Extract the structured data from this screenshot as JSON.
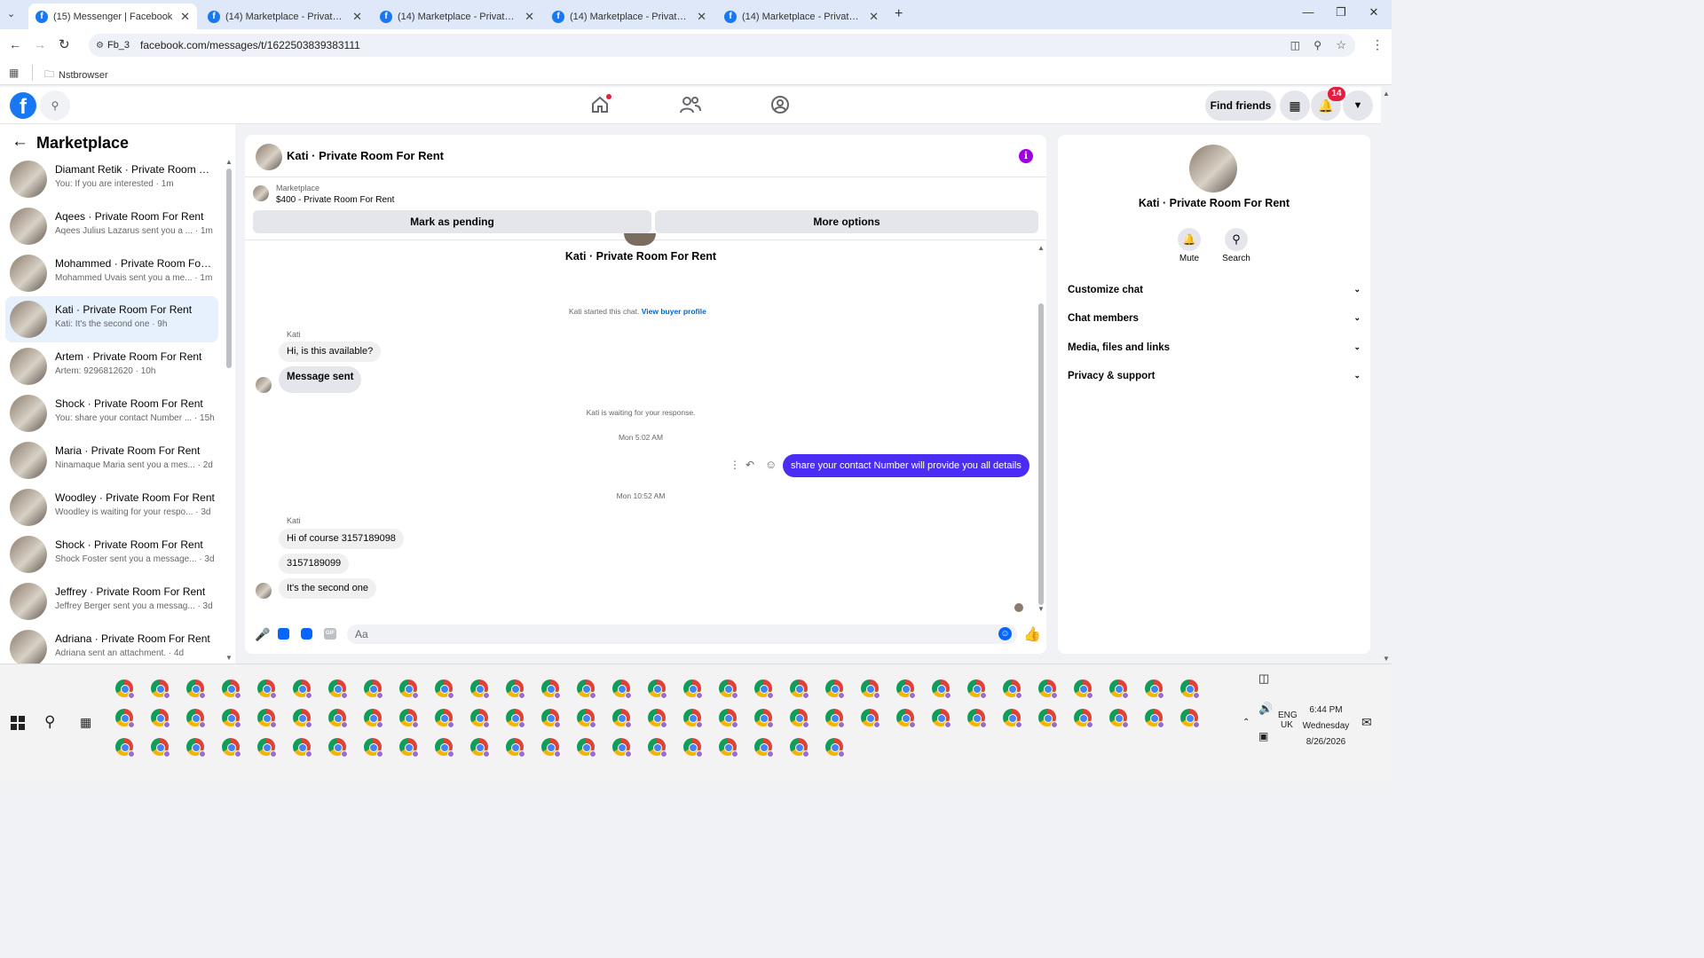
{
  "browser": {
    "tabs": [
      {
        "title": "(15) Messenger | Facebook",
        "active": true
      },
      {
        "title": "(14) Marketplace - Private Room",
        "active": false
      },
      {
        "title": "(14) Marketplace - Private Room",
        "active": false
      },
      {
        "title": "(14) Marketplace - Private Room",
        "active": false
      },
      {
        "title": "(14) Marketplace - Private Room",
        "active": false
      }
    ],
    "profile_chip": "Fb_3",
    "url": "facebook.com/messages/t/1622503839383111",
    "bookmark_folder": "Nstbrowser"
  },
  "fb_header": {
    "find_friends": "Find friends",
    "notification_count": "14"
  },
  "left_panel": {
    "title": "Marketplace",
    "conversations": [
      {
        "name": "Diamant Retik · Private Room For Rent",
        "preview": "You: If you are interested · 1m",
        "selected": false
      },
      {
        "name": "Aqees · Private Room For Rent",
        "preview": "Aqees Julius Lazarus sent you a ... · 1m",
        "selected": false
      },
      {
        "name": "Mohammed · Private Room For Rent",
        "preview": "Mohammed Uvais sent you a me... · 1m",
        "selected": false
      },
      {
        "name": "Kati · Private Room For Rent",
        "preview": "Kati: It's the second one · 9h",
        "selected": true
      },
      {
        "name": "Artem · Private Room For Rent",
        "preview": "Artem: 9296812620 · 10h",
        "selected": false
      },
      {
        "name": "Shock · Private Room For Rent",
        "preview": "You: share your contact Number ... · 15h",
        "selected": false
      },
      {
        "name": "Maria · Private Room For Rent",
        "preview": "Ninamaque Maria sent you a mes... · 2d",
        "selected": false
      },
      {
        "name": "Woodley · Private Room For Rent",
        "preview": "Woodley is waiting for your respo... · 3d",
        "selected": false
      },
      {
        "name": "Shock · Private Room For Rent",
        "preview": "Shock Foster sent you a message... · 3d",
        "selected": false
      },
      {
        "name": "Jeffrey · Private Room For Rent",
        "preview": "Jeffrey Berger sent you a messag... · 3d",
        "selected": false
      },
      {
        "name": "Adriana · Private Room For Rent",
        "preview": "Adriana sent an attachment. · 4d",
        "selected": false
      }
    ]
  },
  "chat": {
    "header_title": "Kati · Private Room For Rent",
    "listing_source": "Marketplace",
    "listing_title": "$400 - Private Room For Rent",
    "mark_pending": "Mark as pending",
    "more_options": "More options",
    "profile_name": "Kati · Private Room For Rent",
    "started_text": "Kati started this chat.",
    "view_buyer_profile": "View buyer profile",
    "sender_name": "Kati",
    "msg_available": "Hi, is this available?",
    "msg_sent": "Message sent",
    "waiting_text": "Kati is waiting for your response.",
    "time_1": "Mon 5:02 AM",
    "my_message": "share your contact Number will provide you all details",
    "time_2": "Mon 10:52 AM",
    "msg_course": "Hi of course 3157189098",
    "msg_number": "3157189099",
    "msg_second": "It's the second one",
    "composer_placeholder": "Aa",
    "accent_color": "#4a2cf5"
  },
  "right_panel": {
    "name": "Kati · Private Room For Rent",
    "mute": "Mute",
    "search": "Search",
    "sections": [
      "Customize chat",
      "Chat members",
      "Media, files and links",
      "Privacy & support"
    ]
  },
  "taskbar": {
    "time": "6:44 PM",
    "day": "Wednesday",
    "date": "8/26/2026",
    "lang1": "ENG",
    "lang2": "UK"
  }
}
